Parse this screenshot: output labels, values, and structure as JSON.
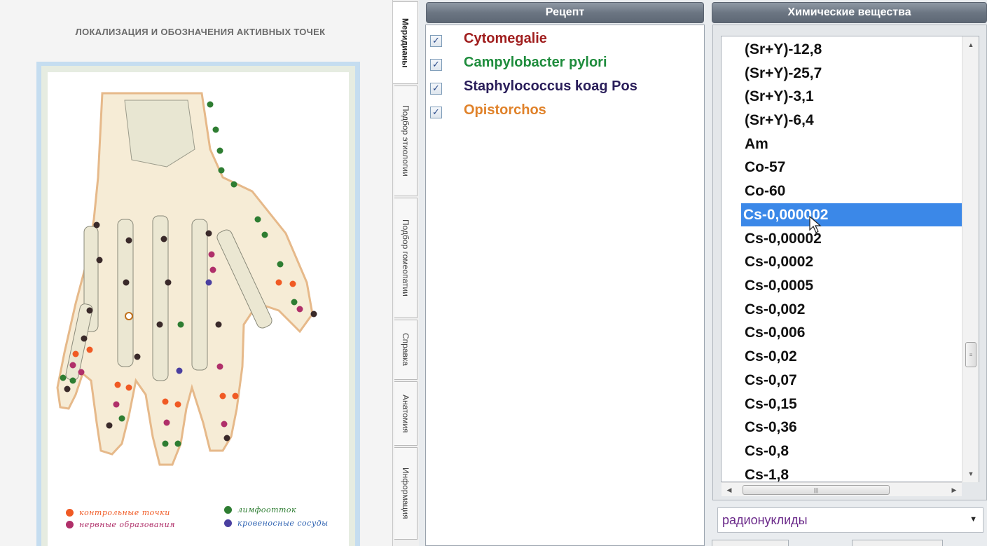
{
  "image_panel": {
    "title": "ЛОКАЛИЗАЦИЯ И ОБОЗНАЧЕНИЯ АКТИВНЫХ ТОЧЕК",
    "legend": [
      {
        "label": "контрольные точки",
        "color": "#f05a24"
      },
      {
        "label": "лимфоотток",
        "color": "#2e7d32"
      },
      {
        "label": "нервные образования",
        "color": "#b0306a"
      },
      {
        "label": "кровеносные сосуды",
        "color": "#4a3fa0"
      }
    ]
  },
  "side_tabs": [
    {
      "label": "Меридианы",
      "active": true
    },
    {
      "label": "Подбор этиологии",
      "active": false
    },
    {
      "label": "Подбор гомеопатии",
      "active": false
    },
    {
      "label": "Справка",
      "active": false
    },
    {
      "label": "Анатомия",
      "active": false
    },
    {
      "label": "Информация",
      "active": false
    }
  ],
  "recipe": {
    "header": "Рецепт",
    "items": [
      {
        "label": "Cytomegalie",
        "checked": true,
        "color": "#a01e1e"
      },
      {
        "label": "Campylobacter pylori",
        "checked": true,
        "color": "#1e8c3c"
      },
      {
        "label": "Staphylococcus koag Pos",
        "checked": true,
        "color": "#2a1e5a"
      },
      {
        "label": "Opistorchos",
        "checked": true,
        "color": "#e0822a"
      }
    ]
  },
  "chemicals": {
    "header": "Химические вещества",
    "items": [
      "(Sr+Y)-12,8",
      "(Sr+Y)-25,7",
      "(Sr+Y)-3,1",
      "(Sr+Y)-6,4",
      "Am",
      "Co-57",
      "Co-60",
      "Cs-0,000002",
      "Cs-0,00002",
      "Cs-0,0002",
      "Cs-0,0005",
      "Cs-0,002",
      "Cs-0,006",
      "Cs-0,02",
      "Cs-0,07",
      "Cs-0,15",
      "Cs-0,36",
      "Cs-0,8",
      "Cs-1,8"
    ],
    "selected": "Cs-0,000002",
    "category": "радионуклиды",
    "accent": "#3b88e8"
  }
}
